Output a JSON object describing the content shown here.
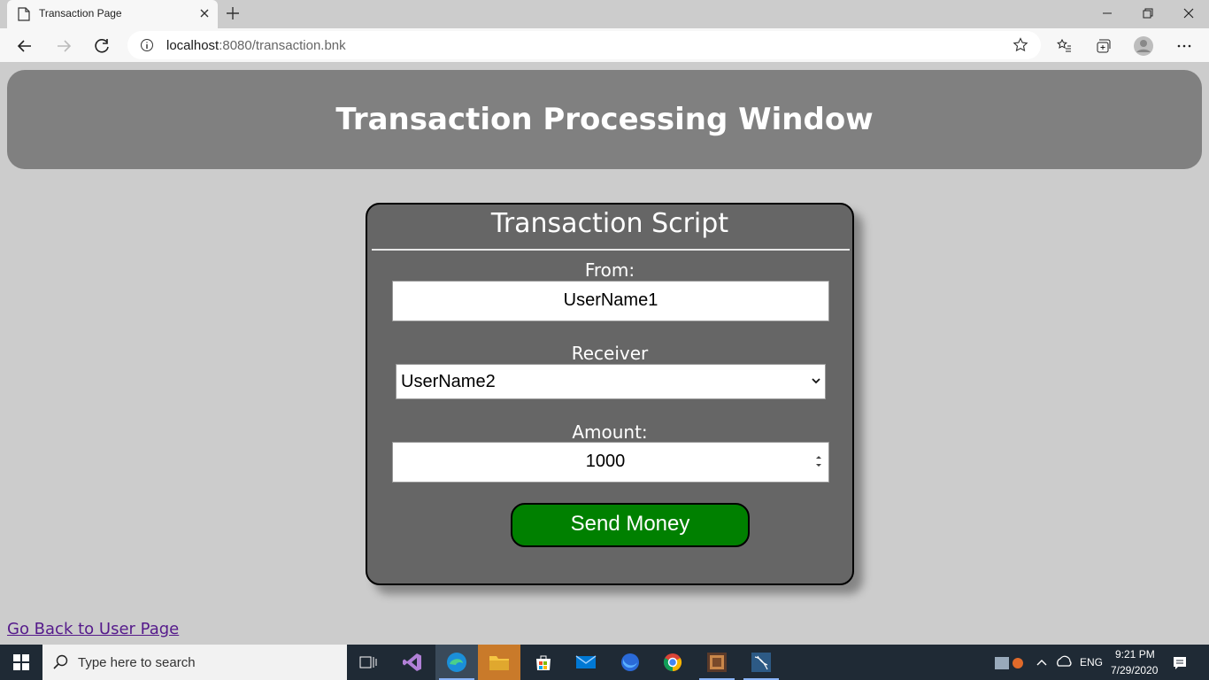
{
  "browser": {
    "tab_title": "Transaction Page",
    "url_host": "localhost",
    "url_path": ":8080/transaction.bnk"
  },
  "page": {
    "banner_title": "Transaction Processing Window",
    "form": {
      "title": "Transaction Script",
      "from_label": "From:",
      "from_value": "UserName1",
      "receiver_label": "Receiver",
      "receiver_selected": "UserName2",
      "amount_label": "Amount:",
      "amount_value": "1000",
      "send_button": "Send Money"
    },
    "back_link": "Go Back to User Page"
  },
  "taskbar": {
    "search_placeholder": "Type here to search",
    "language": "ENG",
    "time": "9:21 PM",
    "date": "7/29/2020"
  },
  "colors": {
    "banner": "#808080",
    "card": "#666666",
    "send_button": "#008000",
    "link": "#551a8b"
  }
}
